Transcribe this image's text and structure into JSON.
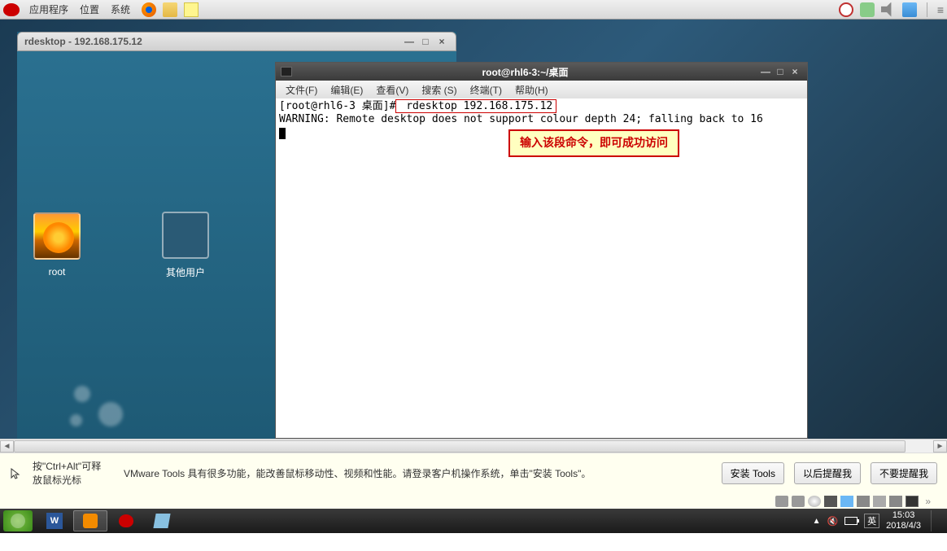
{
  "gnome_panel": {
    "apps": "应用程序",
    "places": "位置",
    "system": "系统"
  },
  "rdesktop": {
    "title": "rdesktop - 192.168.175.12",
    "user_root": "root",
    "user_other": "其他用户"
  },
  "terminal": {
    "title": "root@rhl6-3:~/桌面",
    "menu": {
      "file": "文件(F)",
      "edit": "编辑(E)",
      "view": "查看(V)",
      "search": "搜索 (S)",
      "terminal": "终端(T)",
      "help": "帮助(H)"
    },
    "prompt": "[root@rhl6-3 桌面]#",
    "command": " rdesktop 192.168.175.12 ",
    "warning": "WARNING: Remote desktop does not support colour depth 24; falling back to 16",
    "annotation": "输入该段命令，即可成功访问"
  },
  "vmware_hint": {
    "left_l1": "按\"Ctrl+Alt\"可释",
    "left_l2": "放鼠标光标",
    "msg": "VMware Tools 具有很多功能，能改善鼠标移动性、视频和性能。请登录客户机操作系统，单击\"安装 Tools\"。",
    "btn_install": "安装 Tools",
    "btn_later": "以后提醒我",
    "btn_never": "不要提醒我"
  },
  "win_taskbar": {
    "ime": "英",
    "time": "15:03",
    "date": "2018/4/3"
  }
}
